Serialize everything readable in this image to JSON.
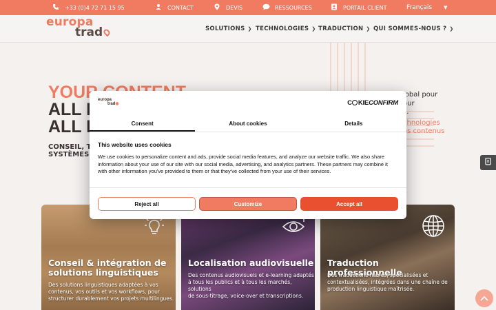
{
  "topbar": {
    "phone": "+33 (0)4 72 71 15 95",
    "contact": "CONTACT",
    "devis": "DEVIS",
    "ressources": "RESSOURCES",
    "portail": "PORTAIL CLIENT",
    "language": "Français"
  },
  "logo": {
    "line1": "europa",
    "line2": "trad"
  },
  "nav": {
    "solutions": "SOLUTIONS",
    "technologies": "TECHNOLOGIES",
    "traduction": "TRADUCTION",
    "qui": "QUI SOMMES-NOUS ?"
  },
  "hero": {
    "title1": "YOUR CONTENT",
    "title2": "ALL L",
    "title3": "ALL L",
    "sub1": "CONSEIL, TR",
    "sub2": "SYSTÈMES N",
    "right1": "lobal pour",
    "right2": "our",
    "right3": "s.",
    "right4": "chnologies",
    "right5": "os contenus"
  },
  "cards": [
    {
      "title_line1": "Conseil & intégration de",
      "title_line2": "solutions linguistiques",
      "text_line1": "Des solutions linguistiques adaptées à vos",
      "text_line2": "contenus, vos outils et vos workflows, pour",
      "text_line3": "structurer durablement vos projets multilingues."
    },
    {
      "title_line1": "Localisation audiovisuelle",
      "text_line1": "Des contenus audiovisuels et e-learning adaptés",
      "text_line2": "à tous les publics et à tous les marchés, solutions",
      "text_line3": "de sous-titrage, voice-over et transcriptions."
    },
    {
      "title_line1": "Traduction professionnelle",
      "text_line1": "Des traductions fiables, spécialisées et",
      "text_line2": "contextualisées,  intégrées dans une chaîne de",
      "text_line3": "production linguistique maîtrisée."
    }
  ],
  "cookie": {
    "logo_line1": "europa",
    "logo_line2": "trad",
    "brand_c": "C",
    "brand_rest": "KIE",
    "brand_confirm": "CONFIRM",
    "tabs": [
      "Consent",
      "About cookies",
      "Details"
    ],
    "heading": "This website uses cookies",
    "body": "We use cookies to personalize content and ads, provide social media features, and analyze our website traffic. We also share information about your use of our site with our social media, advertising, and analytics partners. These partners may combine it with other information you've provided to them or that they've collected from your use of their services.",
    "deny": "Reject all",
    "customize": "Customize",
    "accept": "Accept all"
  },
  "colors": {
    "brand_orange": "#f07b60",
    "accept_red": "#e8502f",
    "dark_text": "#3a3030"
  },
  "icons": {
    "phone": "phone-icon",
    "contact": "contact-icon",
    "devis": "location-pin-icon",
    "ressources": "chat-bubble-icon",
    "portail": "user-badge-icon",
    "card1": "lightbulb-icon",
    "card2": "eye-icon",
    "card3": "globe-icon",
    "side": "document-icon",
    "scroll": "chevron-up-icon"
  }
}
